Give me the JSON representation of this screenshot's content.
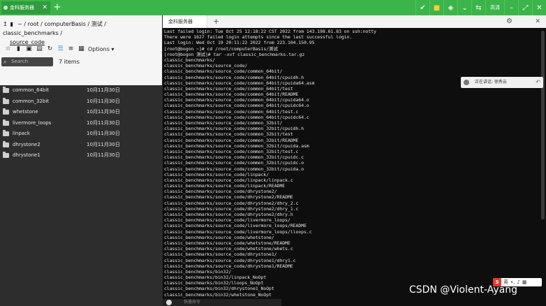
{
  "window": {
    "tab_label": "金科服务器",
    "topbar_text": "高清"
  },
  "left": {
    "breadcrumb": "~ / root / computerBasis / 测试 / classic_benchmarks /",
    "breadcrumb_sub": "source_code",
    "options_label": "Options",
    "search_placeholder": "Search",
    "item_count": "7 items",
    "files": [
      {
        "name": "common_64bit",
        "date": "10月11月30日"
      },
      {
        "name": "common_32bit",
        "date": "10月11月30日"
      },
      {
        "name": "whetstone",
        "date": "10月11月30日"
      },
      {
        "name": "livermore_loops",
        "date": "10月11月30日"
      },
      {
        "name": "linpack",
        "date": "10月11月30日"
      },
      {
        "name": "dhrystone2",
        "date": "10月11月30日"
      },
      {
        "name": "dhrystone1",
        "date": "10月11月30日"
      }
    ]
  },
  "terminal": {
    "tab_label": "金科服务器",
    "input_placeholder": "快速命令",
    "lines": [
      "Last failed login: Tue Oct 25 12:18:22 CST 2022 from 143.198.61.83 on ssh:notty",
      "There were 1627 failed login attempts since the last successful login.",
      "Last login: Wed Oct 19 20:11:22 2022 from 223.104.150.95",
      "[root@bogon ~]# cd /root/computerBasis/测试",
      "[root@bogon 测试]# tar -xvf classic_benchmarks.tar.gz",
      "classic_benchmarks/",
      "classic_benchmarks/source_code/",
      "classic_benchmarks/source_code/common_64bit/",
      "classic_benchmarks/source_code/common_64bit/cpuidh.h",
      "classic_benchmarks/source_code/common_64bit/cpuida64.asm",
      "classic_benchmarks/source_code/common_64bit/test",
      "classic_benchmarks/source_code/common_64bit/README",
      "classic_benchmarks/source_code/common_64bit/cpuida64.o",
      "classic_benchmarks/source_code/common_64bit/cpuidc64.o",
      "classic_benchmarks/source_code/common_64bit/test.c",
      "classic_benchmarks/source_code/common_64bit/cpuidc64.c",
      "classic_benchmarks/source_code/common_32bit/",
      "classic_benchmarks/source_code/common_32bit/cpuidh.h",
      "classic_benchmarks/source_code/common_32bit/test",
      "classic_benchmarks/source_code/common_32bit/README",
      "classic_benchmarks/source_code/common_32bit/cpuida.asm",
      "classic_benchmarks/source_code/common_32bit/test.c",
      "classic_benchmarks/source_code/common_32bit/cpuidc.c",
      "classic_benchmarks/source_code/common_32bit/cpuidc.o",
      "classic_benchmarks/source_code/common_32bit/cpuida.o",
      "classic_benchmarks/source_code/linpack/",
      "classic_benchmarks/source_code/linpack/linpack.c",
      "classic_benchmarks/source_code/linpack/README",
      "classic_benchmarks/source_code/dhrystone2/",
      "classic_benchmarks/source_code/dhrystone2/README",
      "classic_benchmarks/source_code/dhrystone2/dhry_2.c",
      "classic_benchmarks/source_code/dhrystone2/dhry_1.c",
      "classic_benchmarks/source_code/dhrystone2/dhry.h",
      "classic_benchmarks/source_code/livermore_loops/",
      "classic_benchmarks/source_code/livermore_loops/README",
      "classic_benchmarks/source_code/livermore_loops/lloops.c",
      "classic_benchmarks/source_code/whetstone/",
      "classic_benchmarks/source_code/whetstone/README",
      "classic_benchmarks/source_code/whetstone/whets.c",
      "classic_benchmarks/source_code/dhrystone1/",
      "classic_benchmarks/source_code/dhrystone1/dhry1.c",
      "classic_benchmarks/source_code/dhrystone1/README",
      "classic_benchmarks/bin32/",
      "classic_benchmarks/bin32/linpack_NoOpt",
      "classic_benchmarks/bin32/lloops_NoOpt",
      "classic_benchmarks/bin32/dhrystone1_NoOpt",
      "classic_benchmarks/bin32/whetstone_NoOpt"
    ]
  },
  "notification": {
    "text": "正在讲话: 徐秀云"
  },
  "ime": {
    "letter": "S",
    "mode": "英"
  },
  "watermark": "CSDN @Violent-Ayang",
  "colors": {
    "topbar": "#3bb54a",
    "terminal_bg": "#0e0e0e",
    "filelist_bg": "#2d2d2d"
  }
}
